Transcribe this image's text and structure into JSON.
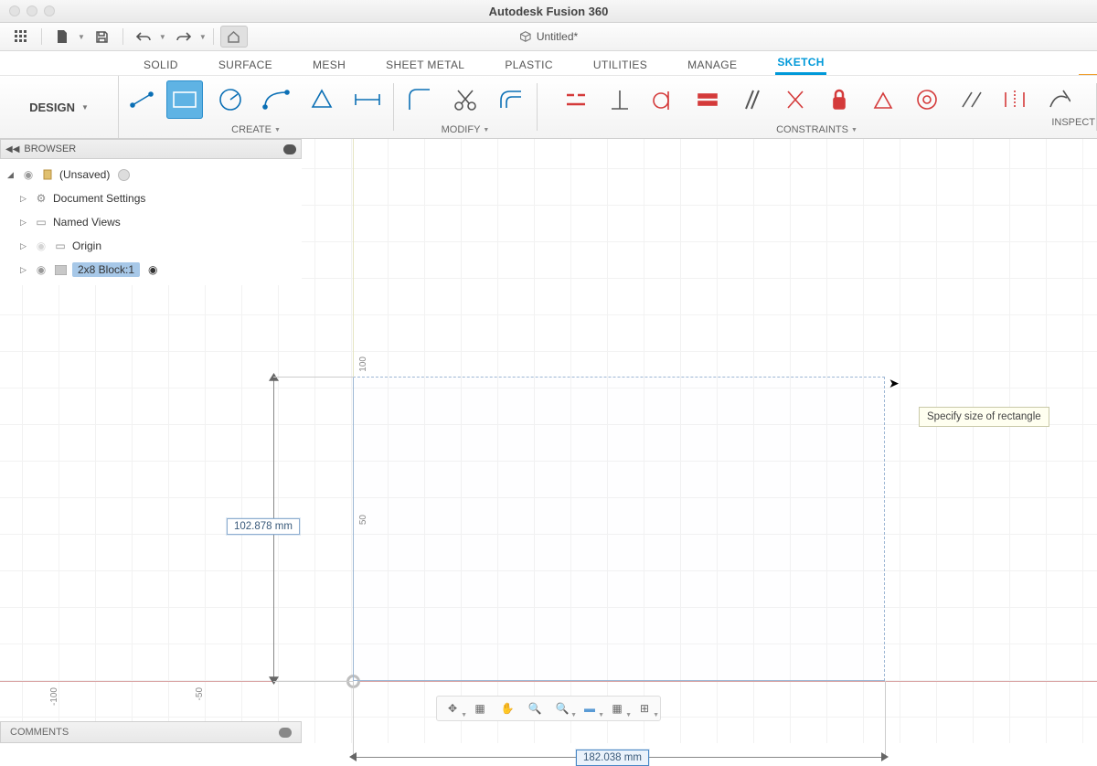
{
  "app": {
    "title": "Autodesk Fusion 360",
    "document": "Untitled*"
  },
  "workspace": "DESIGN",
  "tabs": [
    "SOLID",
    "SURFACE",
    "MESH",
    "SHEET METAL",
    "PLASTIC",
    "UTILITIES",
    "MANAGE",
    "SKETCH"
  ],
  "activeTab": "SKETCH",
  "groups": {
    "create": "CREATE",
    "modify": "MODIFY",
    "constraints": "CONSTRAINTS",
    "inspect": "INSPECT"
  },
  "browser": {
    "title": "BROWSER",
    "root": "(Unsaved)",
    "items": [
      {
        "label": "Document Settings"
      },
      {
        "label": "Named Views"
      },
      {
        "label": "Origin"
      },
      {
        "label": "2x8 Block:1",
        "selected": true
      }
    ]
  },
  "sketch": {
    "width_label": "182.038 mm",
    "height_label": "102.878 mm",
    "tooltip": "Specify size of rectangle",
    "axis": {
      "y100": "100",
      "y50": "50",
      "xn100": "-100",
      "xn50": "-50"
    }
  },
  "comments": "COMMENTS"
}
